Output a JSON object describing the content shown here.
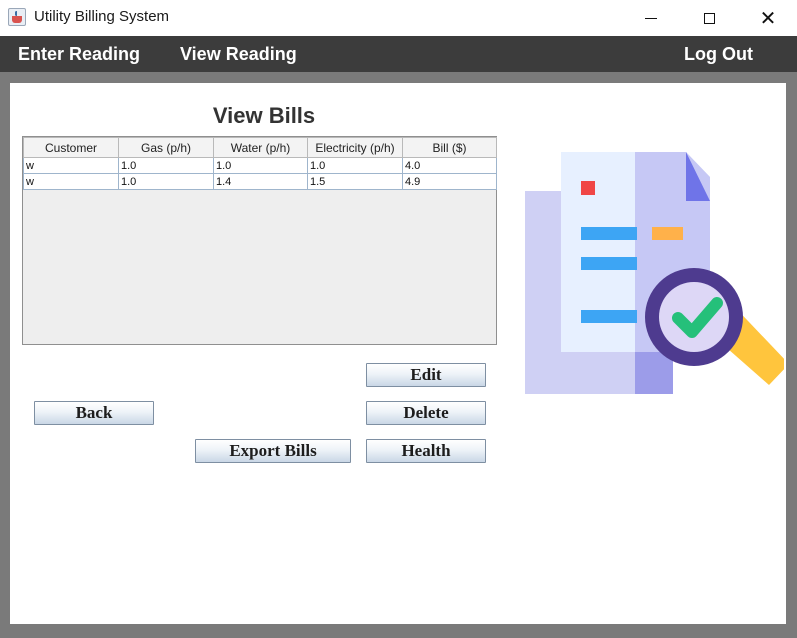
{
  "window": {
    "title": "Utility Billing System"
  },
  "menu": {
    "enter_reading": "Enter Reading",
    "view_reading": "View Reading",
    "log_out": "Log Out"
  },
  "page": {
    "title": "View Bills"
  },
  "table": {
    "headers": [
      "Customer",
      "Gas (p/h)",
      "Water (p/h)",
      "Electricity (p/h)",
      "Bill ($)"
    ],
    "rows": [
      [
        "w",
        "1.0",
        "1.0",
        "1.0",
        "4.0"
      ],
      [
        "w",
        "1.0",
        "1.4",
        "1.5",
        "4.9"
      ]
    ]
  },
  "buttons": {
    "edit": "Edit",
    "back": "Back",
    "delete": "Delete",
    "export": "Export Bills",
    "health": "Health"
  },
  "icons": {
    "app": "java-cup-icon",
    "illustration": "document-search-check-icon"
  },
  "colors": {
    "menubar": "#3c3c3c",
    "accent_blue": "#3da5f4",
    "accent_purple": "#4e3b8f",
    "accent_green": "#25c07a",
    "accent_yellow": "#ffc53d"
  }
}
